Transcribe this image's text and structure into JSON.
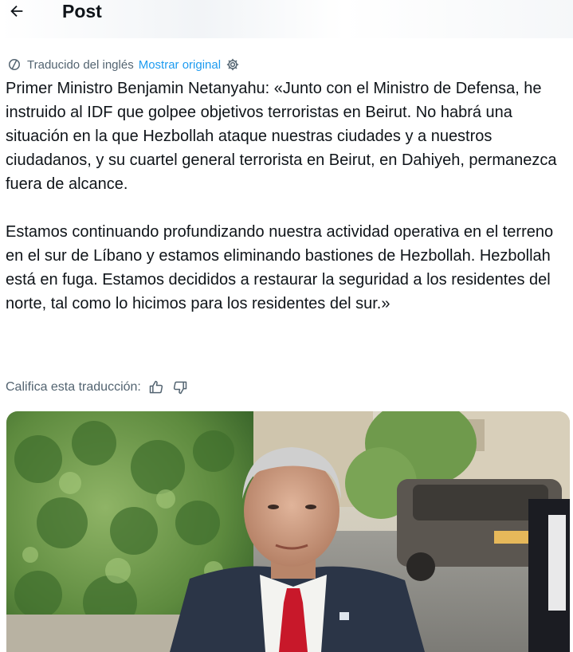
{
  "header": {
    "title": "Post",
    "back_icon": "arrow-left-icon"
  },
  "translation": {
    "label": "Traducido del inglés",
    "show_original": "Mostrar original",
    "icon": "translate-icon",
    "settings_icon": "gear-icon",
    "link_color": "#1d9bf0"
  },
  "post": {
    "paragraph1": "Primer Ministro Benjamin Netanyahu: «Junto con el Ministro de Defensa, he instruido al IDF que golpee objetivos terroristas en Beirut. No habrá una situación en la que Hezbollah ataque nuestras ciudades y a nuestros ciudadanos, y su cuartel general terrorista en Beirut, en Dahiyeh, permanezca fuera de alcance.",
    "paragraph2": "Estamos continuando profundizando nuestra actividad operativa en el terreno en el sur de Líbano y estamos eliminando bastiones de Hezbollah. Hezbollah está en fuga. Estamos decididos a restaurar la seguridad a los residentes del norte, tal como lo hicimos para los residentes del sur.»"
  },
  "rating": {
    "label": "Califica esta traducción:",
    "thumbs_up_icon": "thumbs-up-icon",
    "thumbs_down_icon": "thumbs-down-icon"
  },
  "media": {
    "type": "video-still"
  }
}
